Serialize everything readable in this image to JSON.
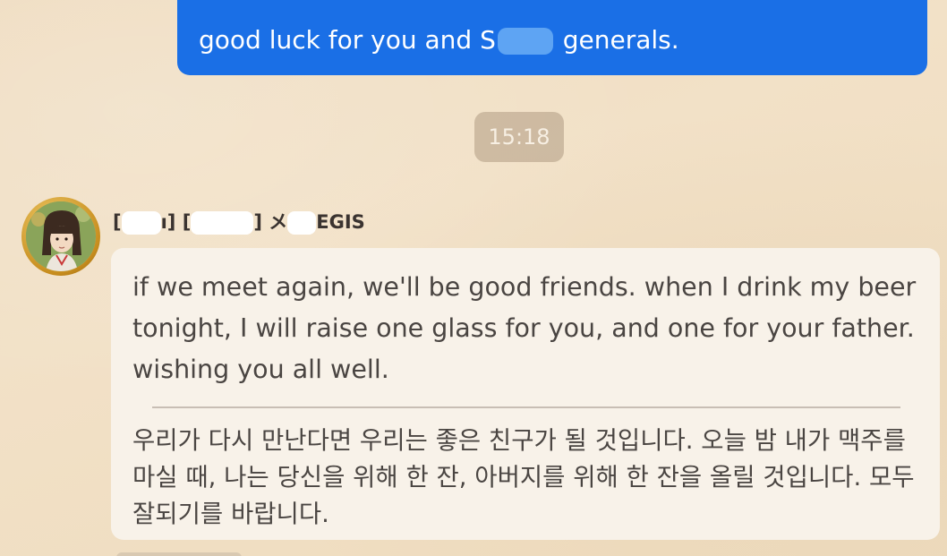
{
  "outgoing_message": {
    "text_before": "good luck for you and S",
    "text_after": " generals."
  },
  "timestamp": "15:18",
  "incoming_message": {
    "sender": {
      "part1": "[",
      "part2": "ı] [",
      "part3": "] メ",
      "part4": "EGIS"
    },
    "english_text": "if we meet again, we'll be good friends. when I drink my beer tonight, I will raise one glass for you, and one for your father. wishing you all well.",
    "korean_text": "우리가 다시 만난다면 우리는 좋은 친구가 될 것입니다. 오늘 밤 내가 맥주를 마실 때, 나는 당신을 위해 한 잔, 아버지를 위해 한 잔을 올릴 것입니다. 모두 잘되기를 바랍니다."
  },
  "colors": {
    "background": "#f0ddc3",
    "outgoing_bubble": "#1a6fe6",
    "incoming_bubble": "#f8f2e9",
    "timestamp_pill": "#b19c82",
    "avatar_ring": "#d9a233"
  },
  "icons": {
    "avatar": "profile-avatar-anime-girl"
  }
}
